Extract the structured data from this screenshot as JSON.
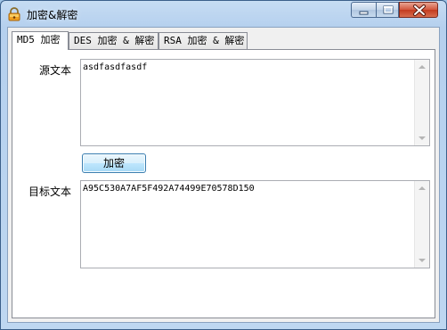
{
  "window": {
    "title": "加密&解密",
    "icon": "lock-app-icon",
    "controls": [
      "minimize-icon",
      "maximize-icon",
      "close-icon"
    ]
  },
  "tabs": [
    {
      "label": "MD5 加密",
      "active": true
    },
    {
      "label": "DES 加密 & 解密",
      "active": false
    },
    {
      "label": "RSA 加密 & 解密",
      "active": false
    }
  ],
  "md5": {
    "source_label": "源文本",
    "source_value": "asdfasdfasdf",
    "encrypt_button": "加密",
    "target_label": "目标文本",
    "target_value": "A95C530A7AF5F492A74499E70578D150"
  },
  "colors": {
    "accent": "#3c7fb1",
    "close_button": "#c33b1f"
  }
}
